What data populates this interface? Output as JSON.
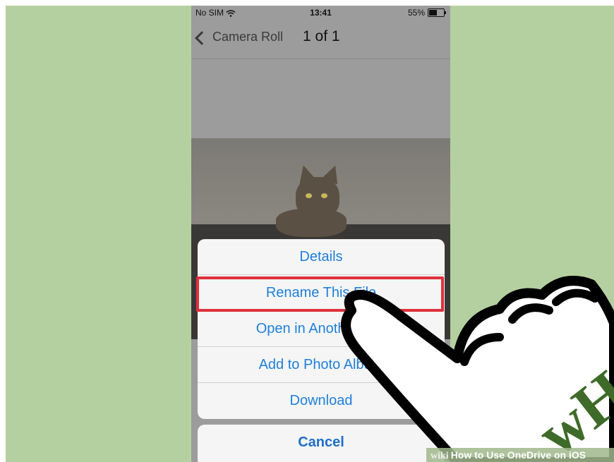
{
  "status_bar": {
    "carrier": "No SIM",
    "time": "13:41",
    "battery": "55%",
    "battery_level": 0.55,
    "icons": [
      "wifi-icon",
      "battery-icon"
    ]
  },
  "nav": {
    "back_label": "Camera Roll",
    "title": "1 of 1"
  },
  "action_sheet": {
    "items": [
      {
        "label": "Details"
      },
      {
        "label": "Rename This File"
      },
      {
        "label": "Open in Another App"
      },
      {
        "label": "Add to Photo Album"
      },
      {
        "label": "Download"
      }
    ],
    "cancel_label": "Cancel"
  },
  "watermark": {
    "logo": "wH",
    "site": "wiki",
    "caption": "How to Use OneDrive on iOS"
  },
  "colors": {
    "background": "#b5d0a0",
    "action_text": "#1f7fdb",
    "highlight": "#e0313b",
    "logo": "#3f6b2a"
  }
}
